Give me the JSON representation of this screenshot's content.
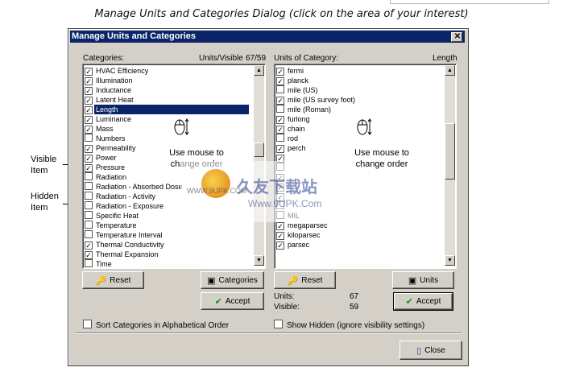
{
  "caption": "Manage Units and Categories Dialog (click on the area of your interest)",
  "callouts": {
    "visible": "Visible\nItem",
    "hidden": "Hidden\nItem"
  },
  "dialog": {
    "title": "Manage Units and Categories",
    "close_glyph": "✕",
    "left": {
      "header_label": "Categories:",
      "header_right": "Units/Visible",
      "header_count": "67/59",
      "items": [
        {
          "label": "HVAC Efficiency",
          "checked": true
        },
        {
          "label": "Illumination",
          "checked": true
        },
        {
          "label": "Inductance",
          "checked": true
        },
        {
          "label": "Latent Heat",
          "checked": true
        },
        {
          "label": "Length",
          "checked": true,
          "selected": true
        },
        {
          "label": "Luminance",
          "checked": true
        },
        {
          "label": "Mass",
          "checked": true
        },
        {
          "label": "Numbers",
          "checked": false
        },
        {
          "label": "Permeability",
          "checked": true
        },
        {
          "label": "Power",
          "checked": true
        },
        {
          "label": "Pressure",
          "checked": true
        },
        {
          "label": "Radiation",
          "checked": false
        },
        {
          "label": "Radiation - Absorbed Dose",
          "checked": false
        },
        {
          "label": "Radiation - Activity",
          "checked": false
        },
        {
          "label": "Radiation - Exposure",
          "checked": false
        },
        {
          "label": "Specific Heat",
          "checked": false
        },
        {
          "label": "Temperature",
          "checked": false
        },
        {
          "label": "Temperature Interval",
          "checked": false
        },
        {
          "label": "Thermal Conductivity",
          "checked": true
        },
        {
          "label": "Thermal Expansion",
          "checked": true
        },
        {
          "label": "Time",
          "checked": false
        }
      ],
      "hint": "Use mouse to change order",
      "reset_label": "Reset",
      "categories_label": "Categories",
      "accept_label": "Accept",
      "sort_label": "Sort Categories in Alphabetical Order"
    },
    "right": {
      "header_label": "Units of Category:",
      "header_value": "Length",
      "items": [
        {
          "label": "fermi",
          "checked": true
        },
        {
          "label": "planck",
          "checked": true
        },
        {
          "label": "mile (US)",
          "checked": false
        },
        {
          "label": "mile (US survey foot)",
          "checked": true
        },
        {
          "label": "mile (Roman)",
          "checked": false
        },
        {
          "label": "furlong",
          "checked": true
        },
        {
          "label": "chain",
          "checked": true
        },
        {
          "label": "rod",
          "checked": false
        },
        {
          "label": "perch",
          "checked": true
        },
        {
          "label": "",
          "checked": true
        },
        {
          "label": "",
          "checked": false
        },
        {
          "label": "",
          "checked": true
        },
        {
          "label": "",
          "checked": true,
          "selected": true
        },
        {
          "label": "",
          "checked": true
        },
        {
          "label": "",
          "checked": false
        },
        {
          "label": "MIL",
          "checked": false
        },
        {
          "label": "megaparsec",
          "checked": true
        },
        {
          "label": "kiloparsec",
          "checked": true
        },
        {
          "label": "parsec",
          "checked": true
        }
      ],
      "hint": "Use mouse to change order",
      "reset_label": "Reset",
      "units_label": "Units",
      "accept_label": "Accept",
      "units_stat_label": "Units:",
      "units_stat_value": "67",
      "visible_stat_label": "Visible:",
      "visible_stat_value": "59",
      "show_hidden_label": "Show Hidden  (ignore visibility settings)"
    },
    "close_label": "Close"
  },
  "watermark": {
    "line1": "久友下载站",
    "line2": "WWW.9UPK.COM",
    "line3": "Www.9UPK.Com"
  },
  "colors": {
    "titlebar": "#0a246a",
    "face": "#d4d0c8",
    "selection": "#0a246a"
  }
}
